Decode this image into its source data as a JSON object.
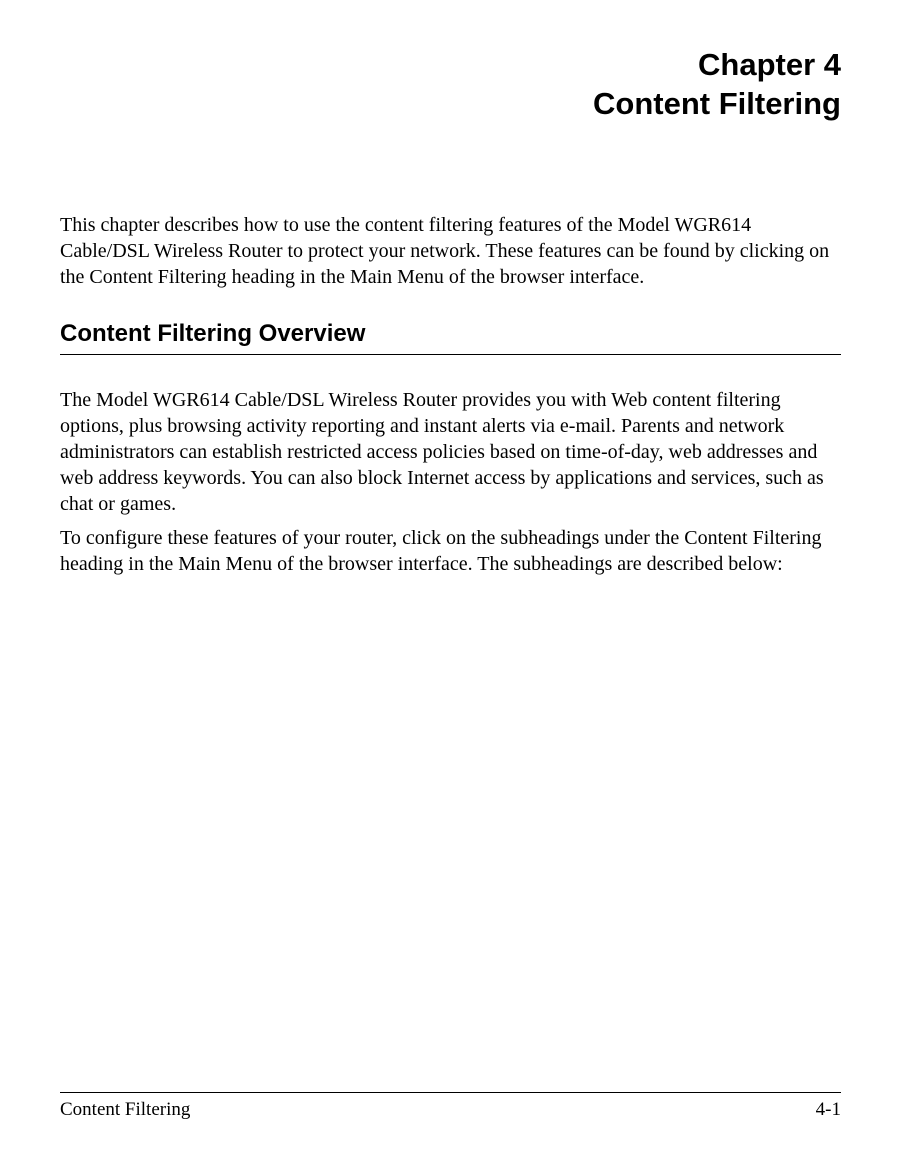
{
  "chapter": {
    "line1": "Chapter 4",
    "line2": "Content Filtering"
  },
  "intro": "This chapter describes how to use the content filtering features of the Model WGR614 Cable/DSL Wireless Router to protect your network. These features can be found by clicking on the Content Filtering heading in the Main Menu of the browser interface.",
  "section_heading": "Content Filtering Overview",
  "para1": "The Model WGR614 Cable/DSL Wireless Router provides you with Web content filtering options, plus browsing activity reporting and instant alerts via e-mail. Parents and network administrators can establish restricted access policies based on time-of-day, web addresses and web address keywords. You can also block Internet access by applications and services, such as chat or games.",
  "para2": "To configure these features of your router, click on the subheadings under the Content Filtering heading in the Main Menu of the browser interface. The subheadings are described below:",
  "footer": {
    "left": "Content Filtering",
    "right": "4-1"
  }
}
